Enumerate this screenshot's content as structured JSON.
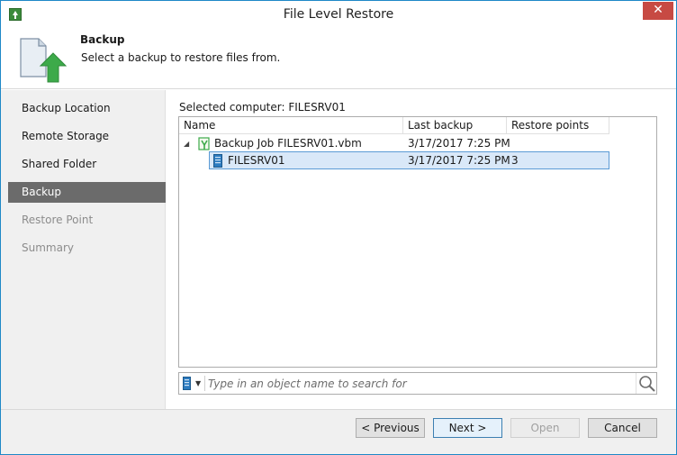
{
  "window": {
    "title": "File Level Restore",
    "close_glyph": "✕"
  },
  "header": {
    "title": "Backup",
    "subtitle": "Select a backup to restore files from."
  },
  "sidebar": {
    "items": [
      {
        "label": "Backup Location",
        "state": "normal"
      },
      {
        "label": "Remote Storage",
        "state": "normal"
      },
      {
        "label": "Shared Folder",
        "state": "normal"
      },
      {
        "label": "Backup",
        "state": "active"
      },
      {
        "label": "Restore Point",
        "state": "disabled"
      },
      {
        "label": "Summary",
        "state": "disabled"
      }
    ]
  },
  "main": {
    "selected_computer_label": "Selected computer: FILESRV01",
    "grid": {
      "columns": [
        "Name",
        "Last backup",
        "Restore points"
      ],
      "rows": [
        {
          "name": "Backup Job FILESRV01.vbm",
          "last_backup": "3/17/2017 7:25 PM",
          "restore_points": "",
          "expanded": true,
          "icon": "backup-job-icon"
        },
        {
          "name": "FILESRV01",
          "last_backup": "3/17/2017 7:25 PM",
          "restore_points": "3",
          "selected": true,
          "icon": "server-icon"
        }
      ],
      "expand_glyph": "◢"
    },
    "search": {
      "placeholder": "Type in an object name to search for",
      "dropdown_glyph": "▼"
    }
  },
  "footer": {
    "previous_label": "< Previous",
    "next_label": "Next >",
    "open_label": "Open",
    "cancel_label": "Cancel"
  },
  "colors": {
    "accent": "#1e88c7",
    "active_nav": "#6b6b6b",
    "selection": "#d9e8f8",
    "close_button": "#c74a43",
    "green_arrow": "#3daa4a"
  }
}
